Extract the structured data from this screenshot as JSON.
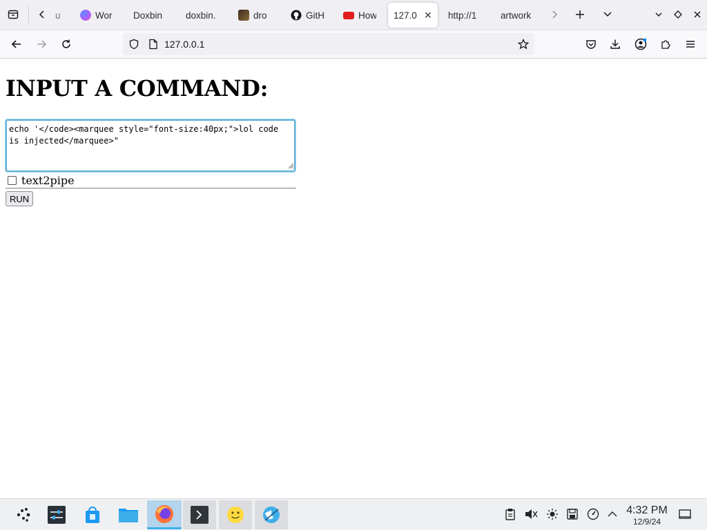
{
  "browser": {
    "tabs": [
      {
        "title": "u",
        "favicon": "generic-page-icon"
      },
      {
        "title": "Wor",
        "favicon": "copilot-icon"
      },
      {
        "title": "Doxbin",
        "favicon": "none"
      },
      {
        "title": "doxbin.",
        "favicon": "none"
      },
      {
        "title": "dro",
        "favicon": "thumbnail-icon"
      },
      {
        "title": "GitH",
        "favicon": "github-icon"
      },
      {
        "title": "How",
        "favicon": "youtube-icon"
      },
      {
        "title": "127.0",
        "favicon": "none",
        "active": true
      },
      {
        "title": "http://1",
        "favicon": "none"
      },
      {
        "title": "artwork",
        "favicon": "none"
      }
    ],
    "url": "127.0.0.1"
  },
  "page": {
    "heading": "INPUT A COMMAND:",
    "command_value": "echo '</code><marquee style=\"font-size:40px;\">lol code is injected</marquee>\"",
    "checkbox_label": "text2pipe",
    "checkbox_checked": false,
    "run_label": "RUN"
  },
  "taskbar": {
    "apps": [
      {
        "name": "application-launcher-icon"
      },
      {
        "name": "system-settings-icon"
      },
      {
        "name": "discover-store-icon"
      },
      {
        "name": "file-manager-icon"
      },
      {
        "name": "firefox-icon",
        "active": true
      },
      {
        "name": "terminal-icon",
        "open": true
      },
      {
        "name": "smiley-app-icon",
        "open": true
      },
      {
        "name": "web-browser-icon",
        "open": true
      }
    ],
    "time": "4:32 PM",
    "date": "12/9/24"
  },
  "colors": {
    "accent": "#3daee9",
    "textarea_focus": "#5fb4d8",
    "firefox_tabbar": "#f0f0f4"
  }
}
